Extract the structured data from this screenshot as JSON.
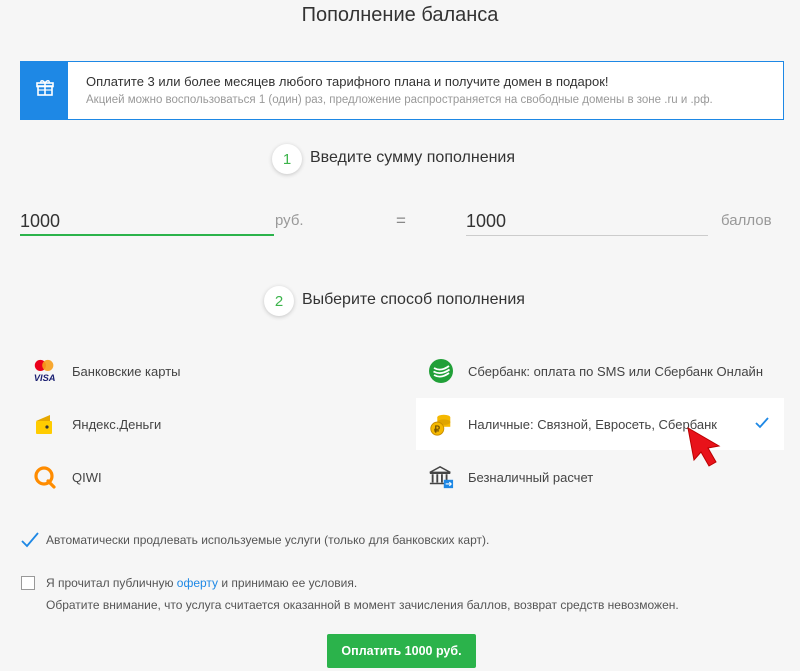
{
  "page_title": "Пополнение баланса",
  "promo": {
    "icon": "gift-icon",
    "title": "Оплатите 3 или более месяцев любого тарифного плана и получите домен в подарок!",
    "subtitle": "Акцией можно воспользоваться 1 (один) раз, предложение распространяется на свободные домены в зоне .ru и .рф."
  },
  "step1": {
    "number": "1",
    "label": "Введите сумму пополнения"
  },
  "amount": {
    "value": "1000",
    "unit": "руб.",
    "equals": "="
  },
  "points": {
    "value": "1000",
    "unit": "баллов"
  },
  "step2": {
    "number": "2",
    "label": "Выберите способ пополнения"
  },
  "methods_left": [
    {
      "label": "Банковские карты",
      "icon": "mastercard-visa-icon"
    },
    {
      "label": "Яндекс.Деньги",
      "icon": "yandex-money-icon"
    },
    {
      "label": "QIWI",
      "icon": "qiwi-icon"
    }
  ],
  "methods_right": [
    {
      "label": "Сбербанк: оплата по SMS или Сбербанк Онлайн",
      "icon": "sberbank-icon"
    },
    {
      "label": "Наличные: Связной, Евросеть, Сбербанк",
      "icon": "coins-icon",
      "selected": true
    },
    {
      "label": "Безналичный расчет",
      "icon": "bank-building-icon"
    }
  ],
  "auto_renew": {
    "checked": true,
    "label": "Автоматически продлевать используемые услуги (только для банковских карт)."
  },
  "agreement": {
    "checked": false,
    "before": "Я прочитал публичную ",
    "link": "оферту",
    "after": " и принимаю ее условия.",
    "note": "Обратите внимание, что услуга считается оказанной в момент зачисления баллов, возврат средств невозможен."
  },
  "pay_button": "Оплатить 1000 руб.",
  "colors": {
    "accent_blue": "#1e88e5",
    "accent_green": "#2bb34b",
    "step_green": "#3cb44b"
  }
}
